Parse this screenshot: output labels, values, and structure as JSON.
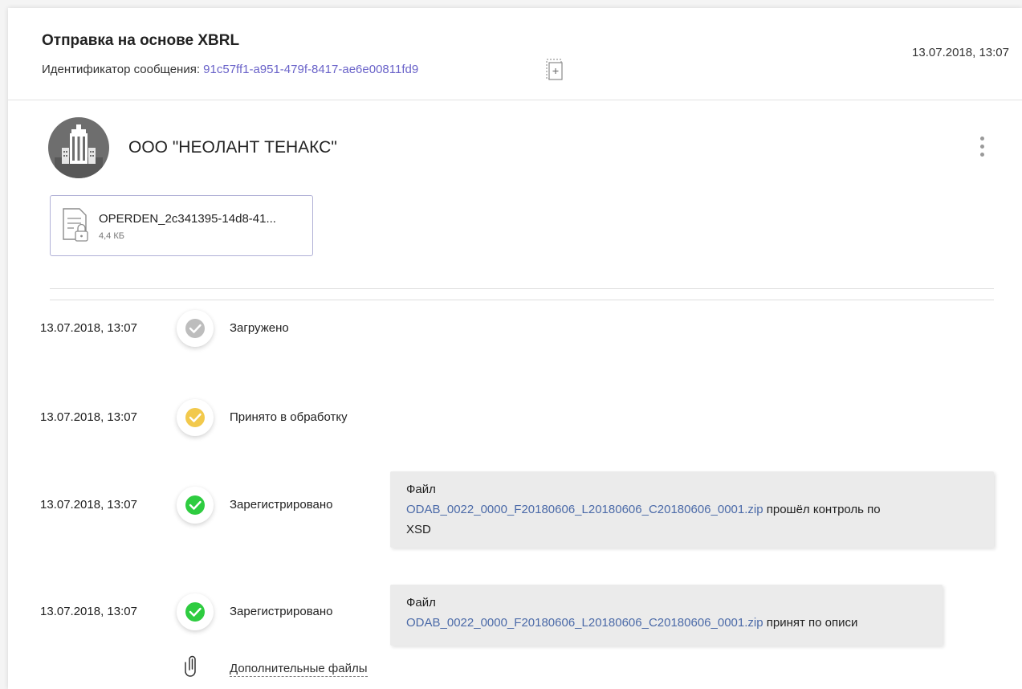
{
  "header": {
    "title": "Отправка на основе XBRL",
    "message_id_label": "Идентификатор сообщения: ",
    "message_id": "91c57ff1-a951-479f-8417-ae6e00811fd9",
    "date": "13.07.2018, 13:07"
  },
  "organization": {
    "name": "ООО \"НЕОЛАНТ ТЕНАКС\"",
    "avatar_icon": "building-icon"
  },
  "file": {
    "name": "OPERDEN_2c341395-14d8-41...",
    "size": "4,4 КБ",
    "icon": "encrypted-document-icon"
  },
  "events": [
    {
      "date": "13.07.2018, 13:07",
      "status": "Загружено",
      "color": "#bdbdbd"
    },
    {
      "date": "13.07.2018, 13:07",
      "status": "Принято в обработку",
      "color": "#f2c94c"
    },
    {
      "date": "13.07.2018, 13:07",
      "status": "Зарегистрировано",
      "color": "#2ecc40",
      "note": {
        "prefix": "Файл",
        "file": "ODAB_0022_0000_F20180606_L20180606_C20180606_0001.zip",
        "text": " прошёл контроль по",
        "text2": "XSD"
      }
    },
    {
      "date": "13.07.2018, 13:07",
      "status": "Зарегистрировано",
      "color": "#2ecc40",
      "note": {
        "prefix": "Файл",
        "file": "ODAB_0022_0000_F20180606_L20180606_C20180606_0001.zip",
        "text": " принят по описи"
      }
    }
  ],
  "extra_files": {
    "label": "Дополнительные файлы",
    "icon": "paperclip-icon"
  },
  "colors": {
    "link": "#6a63c9",
    "file_link": "#4b6aa8",
    "card_border": "#b0b0d6"
  }
}
